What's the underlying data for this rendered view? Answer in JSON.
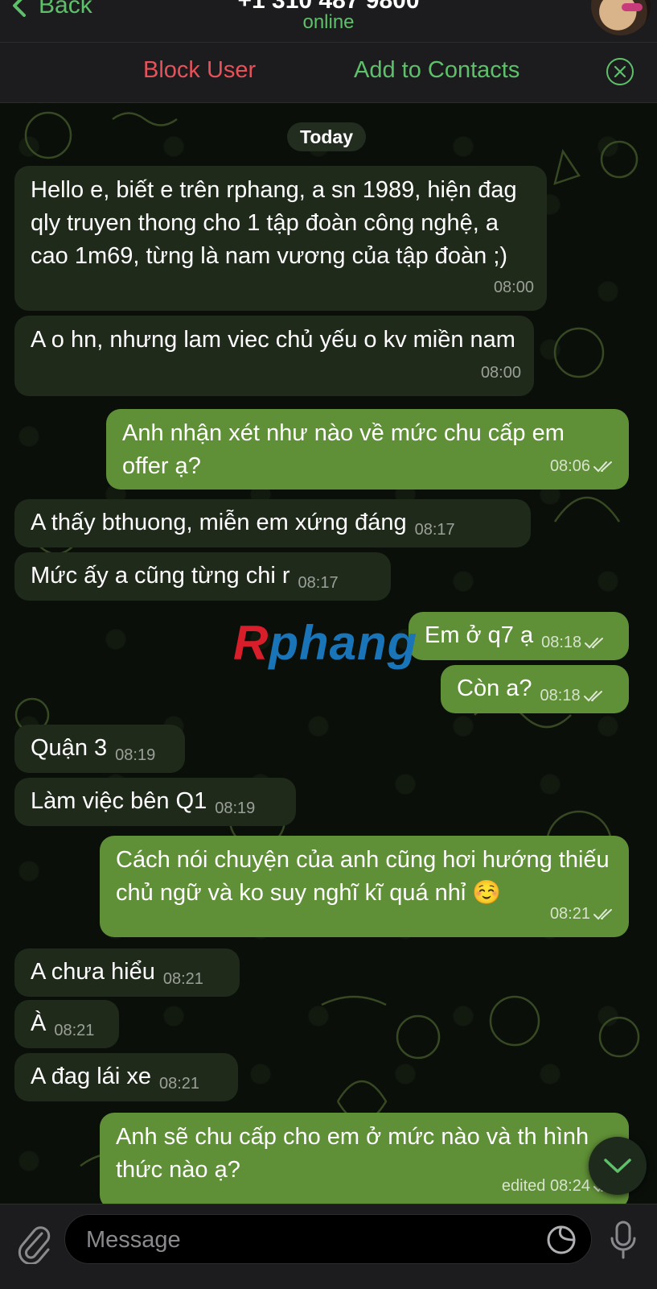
{
  "header": {
    "back_label": "Back",
    "title": "+1 310 487 9800",
    "status": "online"
  },
  "actions": {
    "block_label": "Block User",
    "add_label": "Add to Contacts"
  },
  "chat": {
    "date_separator": "Today",
    "messages": [
      {
        "dir": "in",
        "text": "Hello e, biết e trên rphang, a sn 1989, hiện đag qly truyen thong cho 1 tập đoàn công nghệ, a cao 1m69, từng là nam vương của tập đoàn ;)",
        "time": "08:00"
      },
      {
        "dir": "in",
        "text": "A o hn, nhưng lam viec chủ yếu o kv miền nam",
        "time": "08:00"
      },
      {
        "dir": "out",
        "text": "Anh nhận xét như nào về mức chu cấp em offer ạ?",
        "time": "08:06"
      },
      {
        "dir": "in",
        "text": "A thấy bthuong, miễn em xứng đáng",
        "time": "08:17"
      },
      {
        "dir": "in",
        "text": "Mức ấy a cũng từng chi r",
        "time": "08:17"
      },
      {
        "dir": "out",
        "text": "Em ở q7 ạ",
        "time": "08:18"
      },
      {
        "dir": "out",
        "text": "Còn a?",
        "time": "08:18"
      },
      {
        "dir": "in",
        "text": "Quận 3",
        "time": "08:19"
      },
      {
        "dir": "in",
        "text": "Làm việc bên Q1",
        "time": "08:19"
      },
      {
        "dir": "out",
        "text": "Cách nói chuyện của anh cũng hơi hướng thiếu chủ ngữ và ko suy nghĩ kĩ quá nhỉ ☺️",
        "time": "08:21"
      },
      {
        "dir": "in",
        "text": "A chưa hiểu",
        "time": "08:21"
      },
      {
        "dir": "in",
        "text": "À",
        "time": "08:21"
      },
      {
        "dir": "in",
        "text": "A đag lái xe",
        "time": "08:21"
      },
      {
        "dir": "out",
        "text": "Anh sẽ chu cấp cho em ở mức nào và th hình thức nào ạ?",
        "time": "edited 08:24"
      }
    ],
    "watermark": {
      "first": "R",
      "rest": "phang"
    }
  },
  "composer": {
    "placeholder": "Message"
  },
  "colors": {
    "accent_green": "#5ec06a",
    "danger_red": "#e5535a",
    "outgoing_bubble": "#5f8f36",
    "incoming_bubble": "#1f2a1b"
  },
  "icons": [
    "chevron-left-icon",
    "close-circle-icon",
    "double-check-icon",
    "chevron-down-icon",
    "paperclip-icon",
    "sticker-icon",
    "microphone-icon"
  ]
}
